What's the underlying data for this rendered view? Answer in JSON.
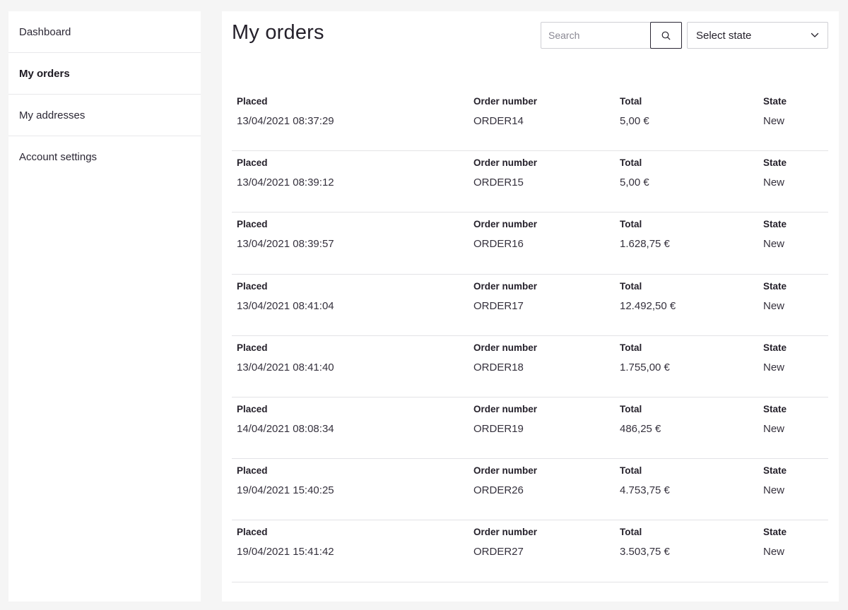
{
  "sidebar": {
    "items": [
      {
        "label": "Dashboard"
      },
      {
        "label": "My orders"
      },
      {
        "label": "My addresses"
      },
      {
        "label": "Account settings"
      }
    ]
  },
  "main": {
    "title": "My orders",
    "search": {
      "placeholder": "Search",
      "value": ""
    },
    "state_select": {
      "label": "Select state"
    },
    "columns": {
      "placed": "Placed",
      "order_number": "Order number",
      "total": "Total",
      "state": "State"
    },
    "orders": [
      {
        "placed": "13/04/2021 08:37:29",
        "number": "ORDER14",
        "total": "5,00 €",
        "state": "New"
      },
      {
        "placed": "13/04/2021 08:39:12",
        "number": "ORDER15",
        "total": "5,00 €",
        "state": "New"
      },
      {
        "placed": "13/04/2021 08:39:57",
        "number": "ORDER16",
        "total": "1.628,75 €",
        "state": "New"
      },
      {
        "placed": "13/04/2021 08:41:04",
        "number": "ORDER17",
        "total": "12.492,50 €",
        "state": "New"
      },
      {
        "placed": "13/04/2021 08:41:40",
        "number": "ORDER18",
        "total": "1.755,00 €",
        "state": "New"
      },
      {
        "placed": "14/04/2021 08:08:34",
        "number": "ORDER19",
        "total": "486,25 €",
        "state": "New"
      },
      {
        "placed": "19/04/2021 15:40:25",
        "number": "ORDER26",
        "total": "4.753,75 €",
        "state": "New"
      },
      {
        "placed": "19/04/2021 15:41:42",
        "number": "ORDER27",
        "total": "3.503,75 €",
        "state": "New"
      }
    ]
  }
}
